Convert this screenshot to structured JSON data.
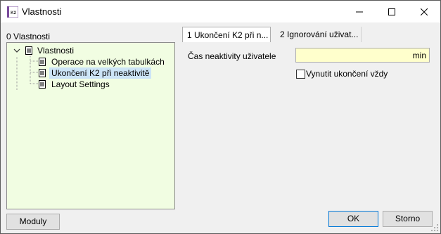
{
  "window": {
    "title": "Vlastnosti",
    "app_icon_text": "K2"
  },
  "left_panel": {
    "label": "0 Vlastnosti",
    "tree": [
      {
        "label": "Vlastnosti",
        "level": 0,
        "expanded": true,
        "selected": false
      },
      {
        "label": "Operace na velkých tabulkách",
        "level": 1,
        "selected": false
      },
      {
        "label": "Ukončení K2 při neaktivitě",
        "level": 1,
        "selected": true
      },
      {
        "label": "Layout Settings",
        "level": 1,
        "selected": false
      }
    ],
    "modules_button": "Moduly"
  },
  "tabs": [
    {
      "label": "1 Ukončení K2 při n...",
      "active": true
    },
    {
      "label": "2 Ignorování uživat...",
      "active": false
    }
  ],
  "form": {
    "inactivity_label": "Čas neaktivity uživatele",
    "inactivity_value": "",
    "inactivity_unit": "min",
    "force_label": "Vynutit ukončení vždy",
    "force_checked": false
  },
  "buttons": {
    "ok": "OK",
    "cancel": "Storno"
  },
  "colors": {
    "tree_bg": "#f1fde2",
    "input_bg": "#ffffcc",
    "selection": "#cce4f7",
    "focus_border": "#0078d7"
  }
}
